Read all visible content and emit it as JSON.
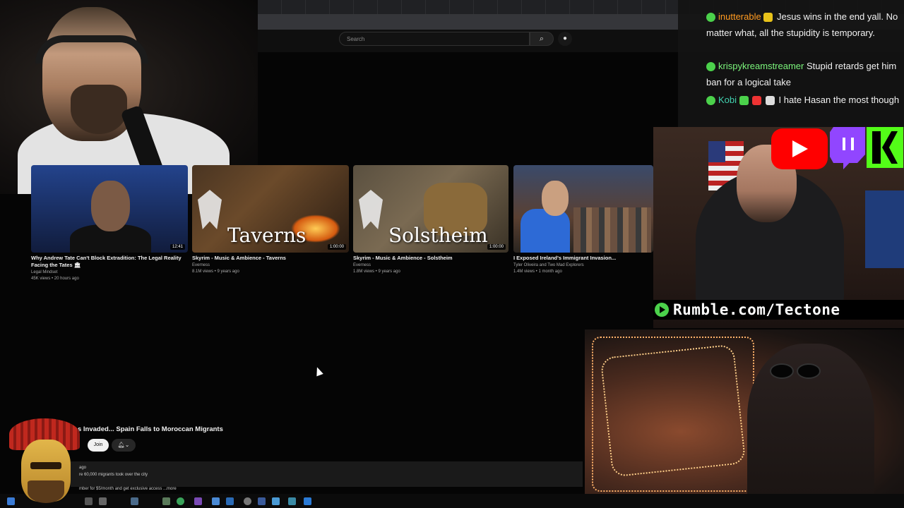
{
  "search": {
    "placeholder": "Search"
  },
  "icons": {
    "search": "search-icon",
    "mic": "microphone-icon",
    "bell": "bell-icon",
    "chat_user": "rumble-user-icon"
  },
  "chat": {
    "messages": [
      {
        "username": "inutterable",
        "text": "Jesus wins in the end yall. No matter what, all the stupidity is temporary.",
        "color": "#ff9a20"
      },
      {
        "username": "krispykreamstreamer",
        "text": "Stupid retards get him ban for a logical take",
        "color": "#7cf57c"
      },
      {
        "username": "Kobi",
        "text": "I hate Hasan the most though",
        "color": "#42d2b0"
      }
    ]
  },
  "overlay": {
    "rumble_text": "Rumble.com/Tectone",
    "brand_colors": {
      "youtube": "#ff0000",
      "twitch": "#9146ff",
      "kick": "#53fc18",
      "rumble": "#4bd14b"
    }
  },
  "videos": [
    {
      "title_line1": "Why Andrew Tate Can't Block Extradition: The Legal Reality",
      "title_line2": "Facing the Tates 🏛",
      "channel": "Legal Mindset",
      "meta": "45K views • 20 hours ago",
      "duration": "12:41"
    },
    {
      "title_line1": "Skyrim - Music & Ambience - Taverns",
      "title_line2": "",
      "channel": "Everness",
      "meta": "8.1M views • 9 years ago",
      "duration": "1:00:00",
      "thumb_text": "Taverns"
    },
    {
      "title_line1": "Skyrim - Music & Ambience - Solstheim",
      "title_line2": "",
      "channel": "Everness",
      "meta": "1.8M views • 9 years ago",
      "duration": "1:00:00",
      "thumb_text": "Solstheim"
    },
    {
      "title_line1": "I Exposed Ireland's Immigrant Invasion...",
      "title_line2": "",
      "channel": "Tyler Oliveira and Two Mad Explorers",
      "meta": "1.4M views • 1 month ago",
      "duration": ""
    }
  ],
  "current_video": {
    "title": "s Invaded... Spain Falls to Moroccan Migrants",
    "join_label": "Join",
    "desc_line1": "ago",
    "desc_line2": "re 60,000 migrants took over the city",
    "desc_line3": "mber for $5/month and get exclusive access ...more"
  }
}
